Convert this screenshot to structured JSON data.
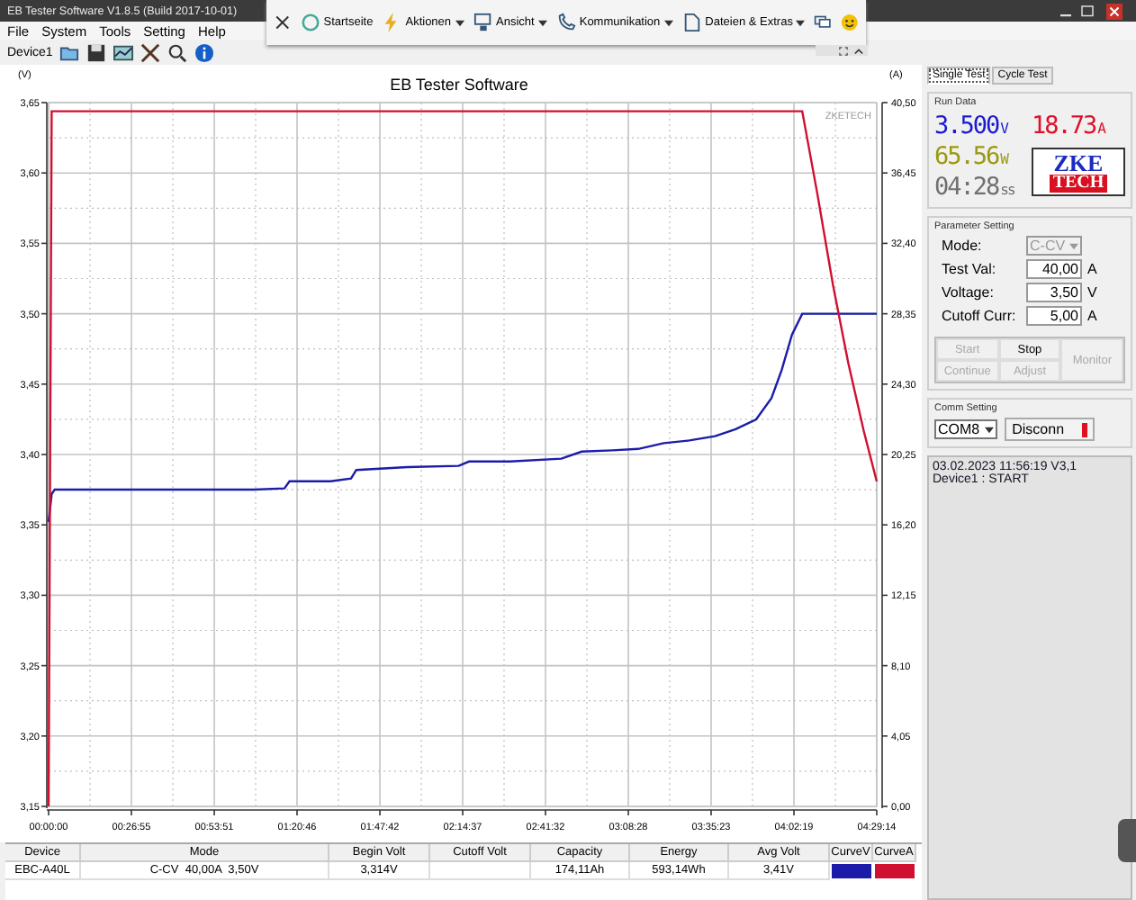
{
  "window": {
    "title": "EB Tester Software V1.8.5 (Build 2017-10-01)"
  },
  "overlay_toolbar": {
    "items": [
      {
        "label": "Startseite",
        "dropdown": false
      },
      {
        "label": "Aktionen",
        "dropdown": true
      },
      {
        "label": "Ansicht",
        "dropdown": true
      },
      {
        "label": "Kommunikation",
        "dropdown": true
      },
      {
        "label": "Dateien & Extras",
        "dropdown": true
      }
    ]
  },
  "menu": [
    "File",
    "System",
    "Tools",
    "Setting",
    "Help"
  ],
  "toolbar": {
    "device": "Device1"
  },
  "chart": {
    "title": "EB Tester Software",
    "left_unit": "(V)",
    "right_unit": "(A)",
    "brand": "ZKETECH",
    "chart_data": {
      "type": "line",
      "grid": true,
      "xlim": [
        0,
        16154
      ],
      "ylim": [
        3.15,
        3.65
      ],
      "y2lim": [
        0,
        40.5
      ],
      "x": [
        0,
        60,
        120,
        1000,
        2000,
        3000,
        4000,
        4600,
        4700,
        5500,
        5900,
        6000,
        7000,
        8000,
        8200,
        9000,
        10000,
        10400,
        11000,
        11500,
        12000,
        12500,
        13000,
        13400,
        13800,
        14100,
        14300,
        14500,
        14700,
        15000,
        15300,
        15600,
        15900,
        16154
      ],
      "series": [
        {
          "color": "#1c1ca8",
          "values": [
            3.352,
            3.372,
            3.375,
            3.375,
            3.375,
            3.375,
            3.375,
            3.376,
            3.381,
            3.381,
            3.383,
            3.389,
            3.391,
            3.392,
            3.395,
            3.395,
            3.397,
            3.402,
            3.403,
            3.404,
            3.408,
            3.41,
            3.413,
            3.418,
            3.425,
            3.44,
            3.46,
            3.485,
            3.5,
            3.5,
            3.5,
            3.5,
            3.5,
            3.5
          ]
        },
        {
          "color": "#d01030",
          "axis": "y2",
          "values": [
            0,
            40.0,
            40.0,
            40.0,
            40.0,
            40.0,
            40.0,
            40.0,
            40.0,
            40.0,
            40.0,
            40.0,
            40.0,
            40.0,
            40.0,
            40.0,
            40.0,
            40.0,
            40.0,
            40.0,
            40.0,
            40.0,
            40.0,
            40.0,
            40.0,
            40.0,
            40.0,
            40.0,
            40.0,
            35.2,
            30.0,
            25.5,
            21.6,
            18.7
          ]
        }
      ],
      "xticks": [
        {
          "value": 0,
          "label": "00:00:00"
        },
        {
          "value": 1615,
          "label": "00:26:55"
        },
        {
          "value": 3231,
          "label": "00:53:51"
        },
        {
          "value": 4846,
          "label": "01:20:46"
        },
        {
          "value": 6462,
          "label": "01:47:42"
        },
        {
          "value": 8077,
          "label": "02:14:37"
        },
        {
          "value": 9692,
          "label": "02:41:32"
        },
        {
          "value": 11308,
          "label": "03:08:28"
        },
        {
          "value": 12923,
          "label": "03:35:23"
        },
        {
          "value": 14539,
          "label": "04:02:19"
        },
        {
          "value": 16154,
          "label": "04:29:14"
        }
      ],
      "yticks": [
        {
          "value": 3.15,
          "label": "3,15"
        },
        {
          "value": 3.2,
          "label": "3,20"
        },
        {
          "value": 3.25,
          "label": "3,25"
        },
        {
          "value": 3.3,
          "label": "3,30"
        },
        {
          "value": 3.35,
          "label": "3,35"
        },
        {
          "value": 3.4,
          "label": "3,40"
        },
        {
          "value": 3.45,
          "label": "3,45"
        },
        {
          "value": 3.5,
          "label": "3,50"
        },
        {
          "value": 3.55,
          "label": "3,55"
        },
        {
          "value": 3.6,
          "label": "3,60"
        },
        {
          "value": 3.65,
          "label": "3,65"
        }
      ],
      "y2ticks": [
        {
          "value": 0,
          "label": "0,00"
        },
        {
          "value": 4.05,
          "label": "4,05"
        },
        {
          "value": 8.1,
          "label": "8,10"
        },
        {
          "value": 12.15,
          "label": "12,15"
        },
        {
          "value": 16.2,
          "label": "16,20"
        },
        {
          "value": 20.25,
          "label": "20,25"
        },
        {
          "value": 24.3,
          "label": "24,30"
        },
        {
          "value": 28.35,
          "label": "28,35"
        },
        {
          "value": 32.4,
          "label": "32,40"
        },
        {
          "value": 36.45,
          "label": "36,45"
        },
        {
          "value": 40.5,
          "label": "40,50"
        }
      ]
    }
  },
  "table": {
    "columns": [
      "Device",
      "Mode",
      "Begin Volt",
      "Cutoff Volt",
      "Capacity",
      "Energy",
      "Avg Volt",
      "CurveV",
      "CurveA"
    ],
    "rows": [
      {
        "cells": [
          "EBC-A40L",
          "C-CV  40,00A  3,50V",
          "3,314V",
          "",
          "174,11Ah",
          "593,14Wh",
          "3,41V"
        ]
      }
    ]
  },
  "tabs": [
    {
      "label": "Single Test",
      "selected": true
    },
    {
      "label": "Cycle Test",
      "selected": false
    }
  ],
  "run_data": {
    "title": "Run Data",
    "readings": [
      {
        "value": "3.500",
        "unit": "V",
        "color": "#1a1ad0"
      },
      {
        "value": "18.73",
        "unit": "A",
        "color": "#e0102a"
      },
      {
        "value": "65.56",
        "unit": "W",
        "color": "#9a9a10"
      },
      {
        "value": "04:28",
        "unit": "ss",
        "color": "#707070"
      }
    ],
    "logo": [
      "ZKE",
      "TECH"
    ]
  },
  "parameters": {
    "title": "Parameter Setting",
    "fields": [
      {
        "label": "Mode:",
        "value": "C-CV",
        "kind": "dropdown",
        "disabled": true
      },
      {
        "label": "Test Val:",
        "value": "40,00",
        "unit": "A",
        "kind": "input",
        "disabled": false
      },
      {
        "label": "Voltage:",
        "value": "3,50",
        "unit": "V",
        "kind": "input",
        "disabled": false
      },
      {
        "label": "Cutoff Curr:",
        "value": "5,00",
        "unit": "A",
        "kind": "input",
        "disabled": false
      }
    ]
  },
  "buttons": [
    {
      "label": "Start",
      "disabled": true
    },
    {
      "label": "Stop",
      "disabled": false
    },
    {
      "label": "Monitor",
      "disabled": true
    },
    {
      "label": "Continue",
      "disabled": true
    },
    {
      "label": "Adjust",
      "disabled": true
    }
  ],
  "comm": {
    "title": "Comm Setting",
    "port": "COM8",
    "button": "Disconn",
    "connected": true
  },
  "log": [
    "03.02.2023 11:56:19  V3,1",
    "Device1 : START"
  ]
}
